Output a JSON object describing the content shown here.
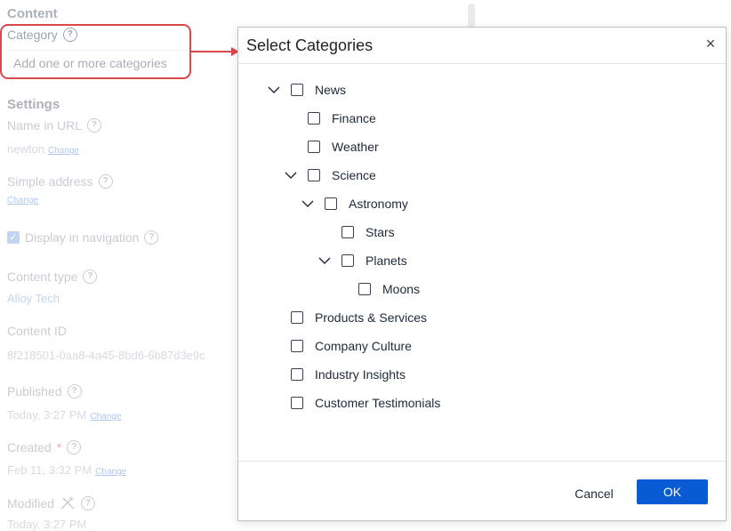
{
  "background": {
    "content_title": "Content",
    "category": {
      "label": "Category",
      "placeholder": "Add one or more categories"
    },
    "settings_title": "Settings",
    "name_in_url": {
      "label": "Name in URL",
      "value": "newton",
      "change": "Change"
    },
    "simple_address": {
      "label": "Simple address",
      "change": "Change"
    },
    "display_in_navigation": {
      "label": "Display in navigation",
      "checked": true
    },
    "content_type": {
      "label": "Content type",
      "value": "Alloy Tech"
    },
    "content_id": {
      "label": "Content ID",
      "value": "8f218501-0aa8-4a45-8bd6-6b87d3e9c"
    },
    "published": {
      "label": "Published",
      "value": "Today, 3:27 PM",
      "change": "Change"
    },
    "created": {
      "label": "Created",
      "required_mark": "*",
      "value": "Feb 11, 3:32 PM",
      "change": "Change"
    },
    "modified": {
      "label": "Modified",
      "value": "Today, 3:27 PM"
    },
    "help_glyph": "?"
  },
  "dialog": {
    "title": "Select Categories",
    "close_glyph": "×",
    "tree": [
      {
        "label": "News",
        "depth": 0,
        "expandable": true,
        "checked": false
      },
      {
        "label": "Finance",
        "depth": 1,
        "expandable": false,
        "checked": false
      },
      {
        "label": "Weather",
        "depth": 1,
        "expandable": false,
        "checked": false
      },
      {
        "label": "Science",
        "depth": 1,
        "expandable": true,
        "checked": false
      },
      {
        "label": "Astronomy",
        "depth": 2,
        "expandable": true,
        "checked": false
      },
      {
        "label": "Stars",
        "depth": 3,
        "expandable": false,
        "checked": false
      },
      {
        "label": "Planets",
        "depth": 3,
        "expandable": true,
        "checked": false
      },
      {
        "label": "Moons",
        "depth": 4,
        "expandable": false,
        "checked": false
      },
      {
        "label": "Products & Services",
        "depth": 0,
        "expandable": false,
        "checked": false
      },
      {
        "label": "Company Culture",
        "depth": 0,
        "expandable": false,
        "checked": false
      },
      {
        "label": "Industry Insights",
        "depth": 0,
        "expandable": false,
        "checked": false
      },
      {
        "label": "Customer Testimonials",
        "depth": 0,
        "expandable": false,
        "checked": false
      }
    ],
    "cancel_label": "Cancel",
    "ok_label": "OK"
  },
  "colors": {
    "accent": "#0a5ad3",
    "highlight": "#d9484b"
  }
}
